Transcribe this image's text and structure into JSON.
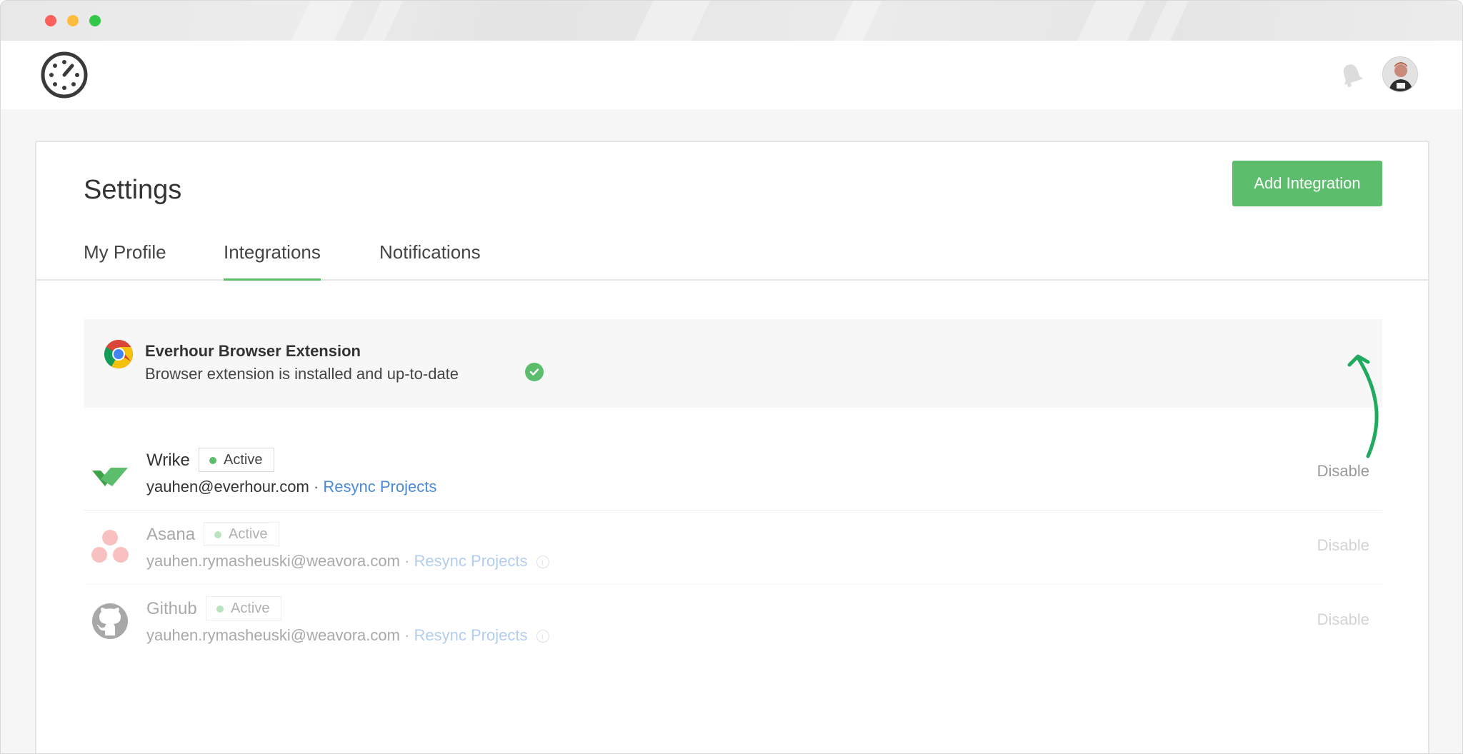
{
  "window": {
    "controls": [
      "close",
      "minimize",
      "maximize"
    ]
  },
  "header": {
    "logo_icon": "stopwatch-logo-icon",
    "notification_icon": "bell-icon",
    "avatar_icon": "user-avatar"
  },
  "settings": {
    "title": "Settings",
    "add_integration_label": "Add Integration",
    "tabs": [
      {
        "label": "My Profile",
        "active": false
      },
      {
        "label": "Integrations",
        "active": true
      },
      {
        "label": "Notifications",
        "active": false
      }
    ]
  },
  "extension": {
    "icon": "chrome-icon",
    "title": "Everhour Browser Extension",
    "status": "Browser extension is installed and up-to-date",
    "status_icon": "check-circle-icon"
  },
  "integrations": [
    {
      "name": "Wrike",
      "icon": "wrike-icon",
      "status": "Active",
      "email": "yauhen@everhour.com",
      "separator": "·",
      "resync_label": "Resync Projects",
      "disable_label": "Disable",
      "faded": false,
      "info": false
    },
    {
      "name": "Asana",
      "icon": "asana-icon",
      "status": "Active",
      "email": "yauhen.rymasheuski@weavora.com",
      "separator": "·",
      "resync_label": "Resync Projects",
      "info_label": "i",
      "disable_label": "Disable",
      "faded": true,
      "info": true
    },
    {
      "name": "Github",
      "icon": "github-icon",
      "status": "Active",
      "email": "yauhen.rymasheuski@weavora.com",
      "separator": "·",
      "resync_label": "Resync Projects",
      "info_label": "i",
      "disable_label": "Disable",
      "faded": true,
      "info": true
    }
  ],
  "colors": {
    "accent": "#5cbd6c",
    "link": "#4a8ad8",
    "arrow": "#1faa5e"
  }
}
